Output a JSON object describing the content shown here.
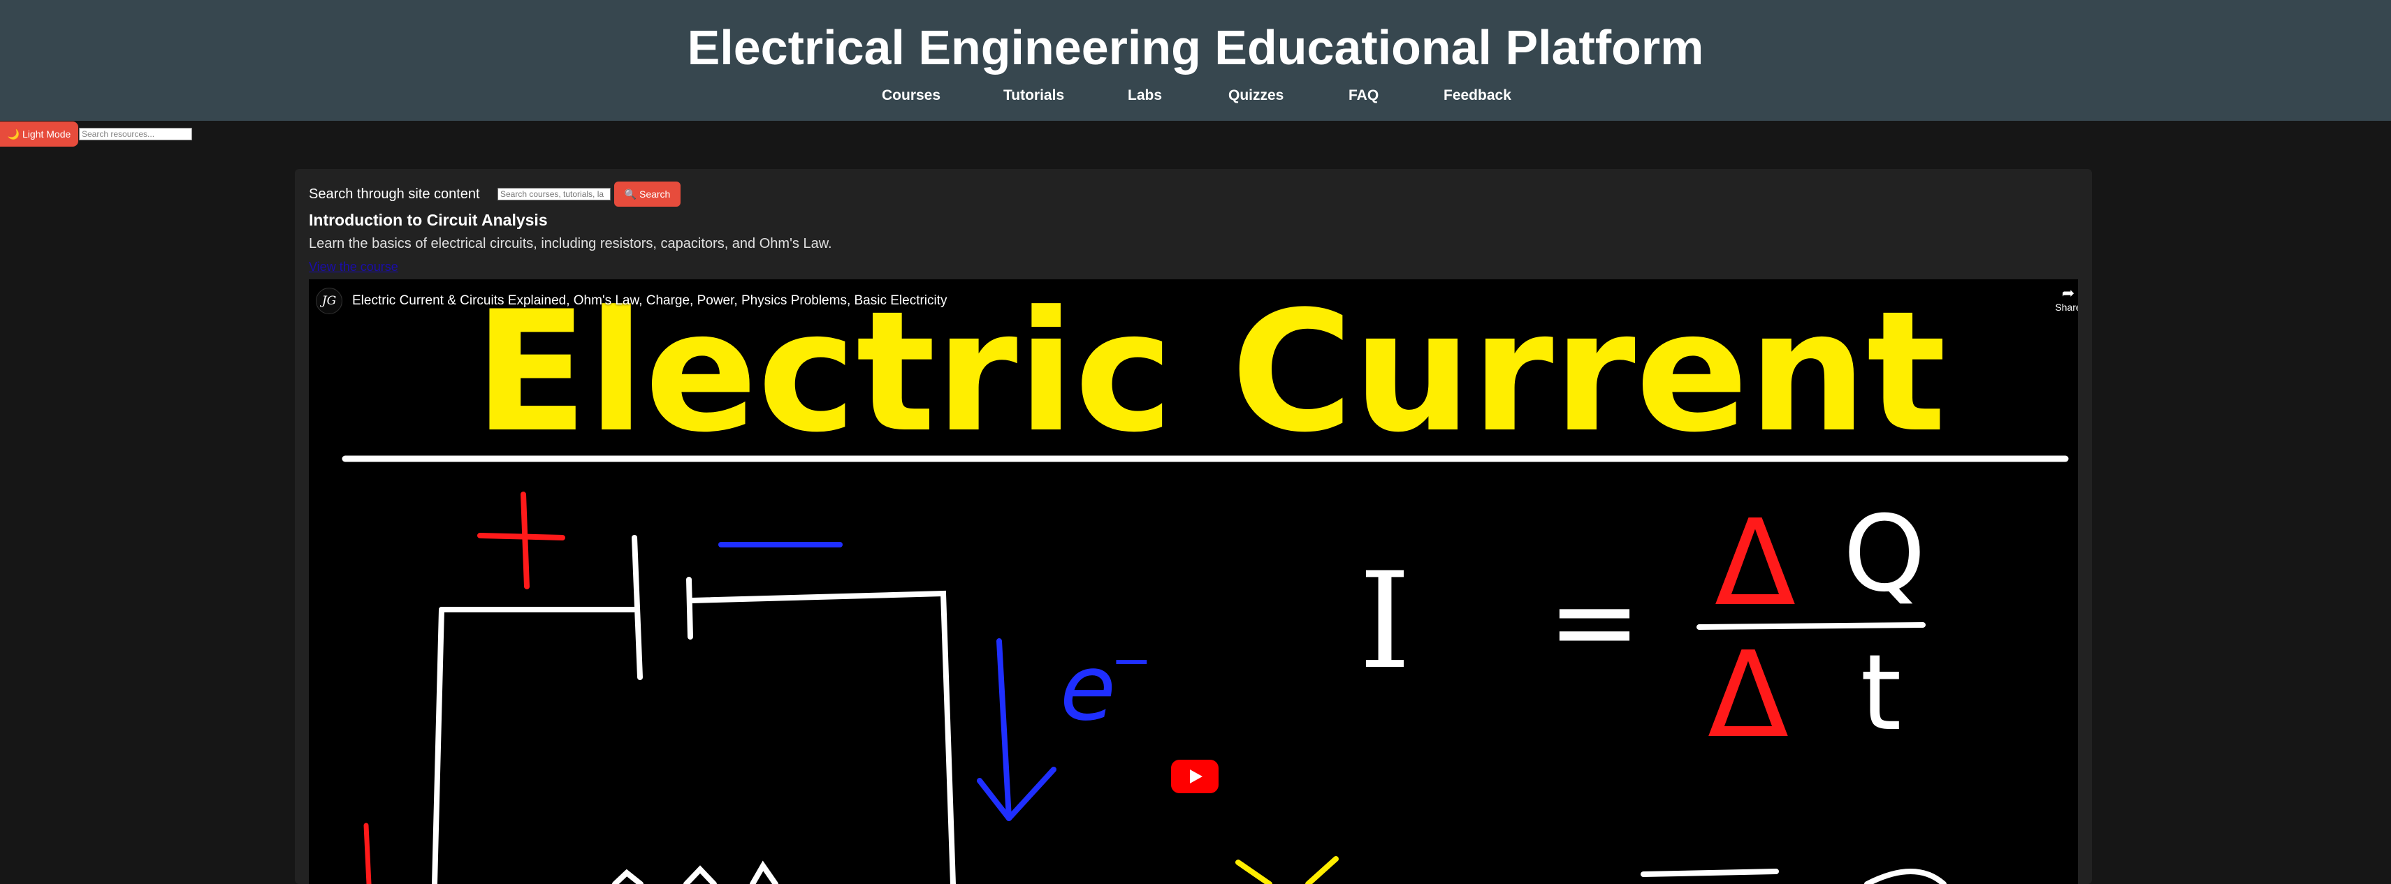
{
  "header": {
    "title": "Electrical Engineering Educational Platform",
    "nav": [
      {
        "label": "Courses"
      },
      {
        "label": "Tutorials"
      },
      {
        "label": "Labs"
      },
      {
        "label": "Quizzes"
      },
      {
        "label": "FAQ"
      },
      {
        "label": "Feedback"
      }
    ]
  },
  "theme_toggle": {
    "label": "🌙 Light Mode",
    "icon": "moon-icon"
  },
  "quick_search": {
    "placeholder": "Search resources..."
  },
  "site_search": {
    "label": "Search through site content",
    "placeholder": "Search courses, tutorials, la",
    "button_label": "🔍 Search",
    "button_icon": "search-icon"
  },
  "course": {
    "title": "Introduction to Circuit Analysis",
    "description": "Learn the basics of electrical circuits, including resistors, capacitors, and Ohm's Law.",
    "link": "View the course"
  },
  "video": {
    "channel_initials": "JG",
    "title": "Electric Current & Circuits Explained, Ohm's Law, Charge, Power, Physics Problems, Basic Electricity",
    "share_label": "Share",
    "thumbnail_heading": "Electric Current",
    "thumbnail_labels": {
      "plus": "+",
      "minus": "−",
      "electron": "e",
      "electron_sign": "−",
      "equation_lhs": "I",
      "equals": "=",
      "delta": "Δ",
      "charge": "Q",
      "time": "t"
    }
  },
  "colors": {
    "header_bg": "#37474f",
    "page_bg": "#161616",
    "panel_bg": "#222222",
    "accent": "#e74c3c",
    "link": "#1a0dab",
    "thumbnail_yellow": "#ffee00",
    "thumbnail_red": "#ff1a1a",
    "thumbnail_blue": "#1f2fff"
  }
}
